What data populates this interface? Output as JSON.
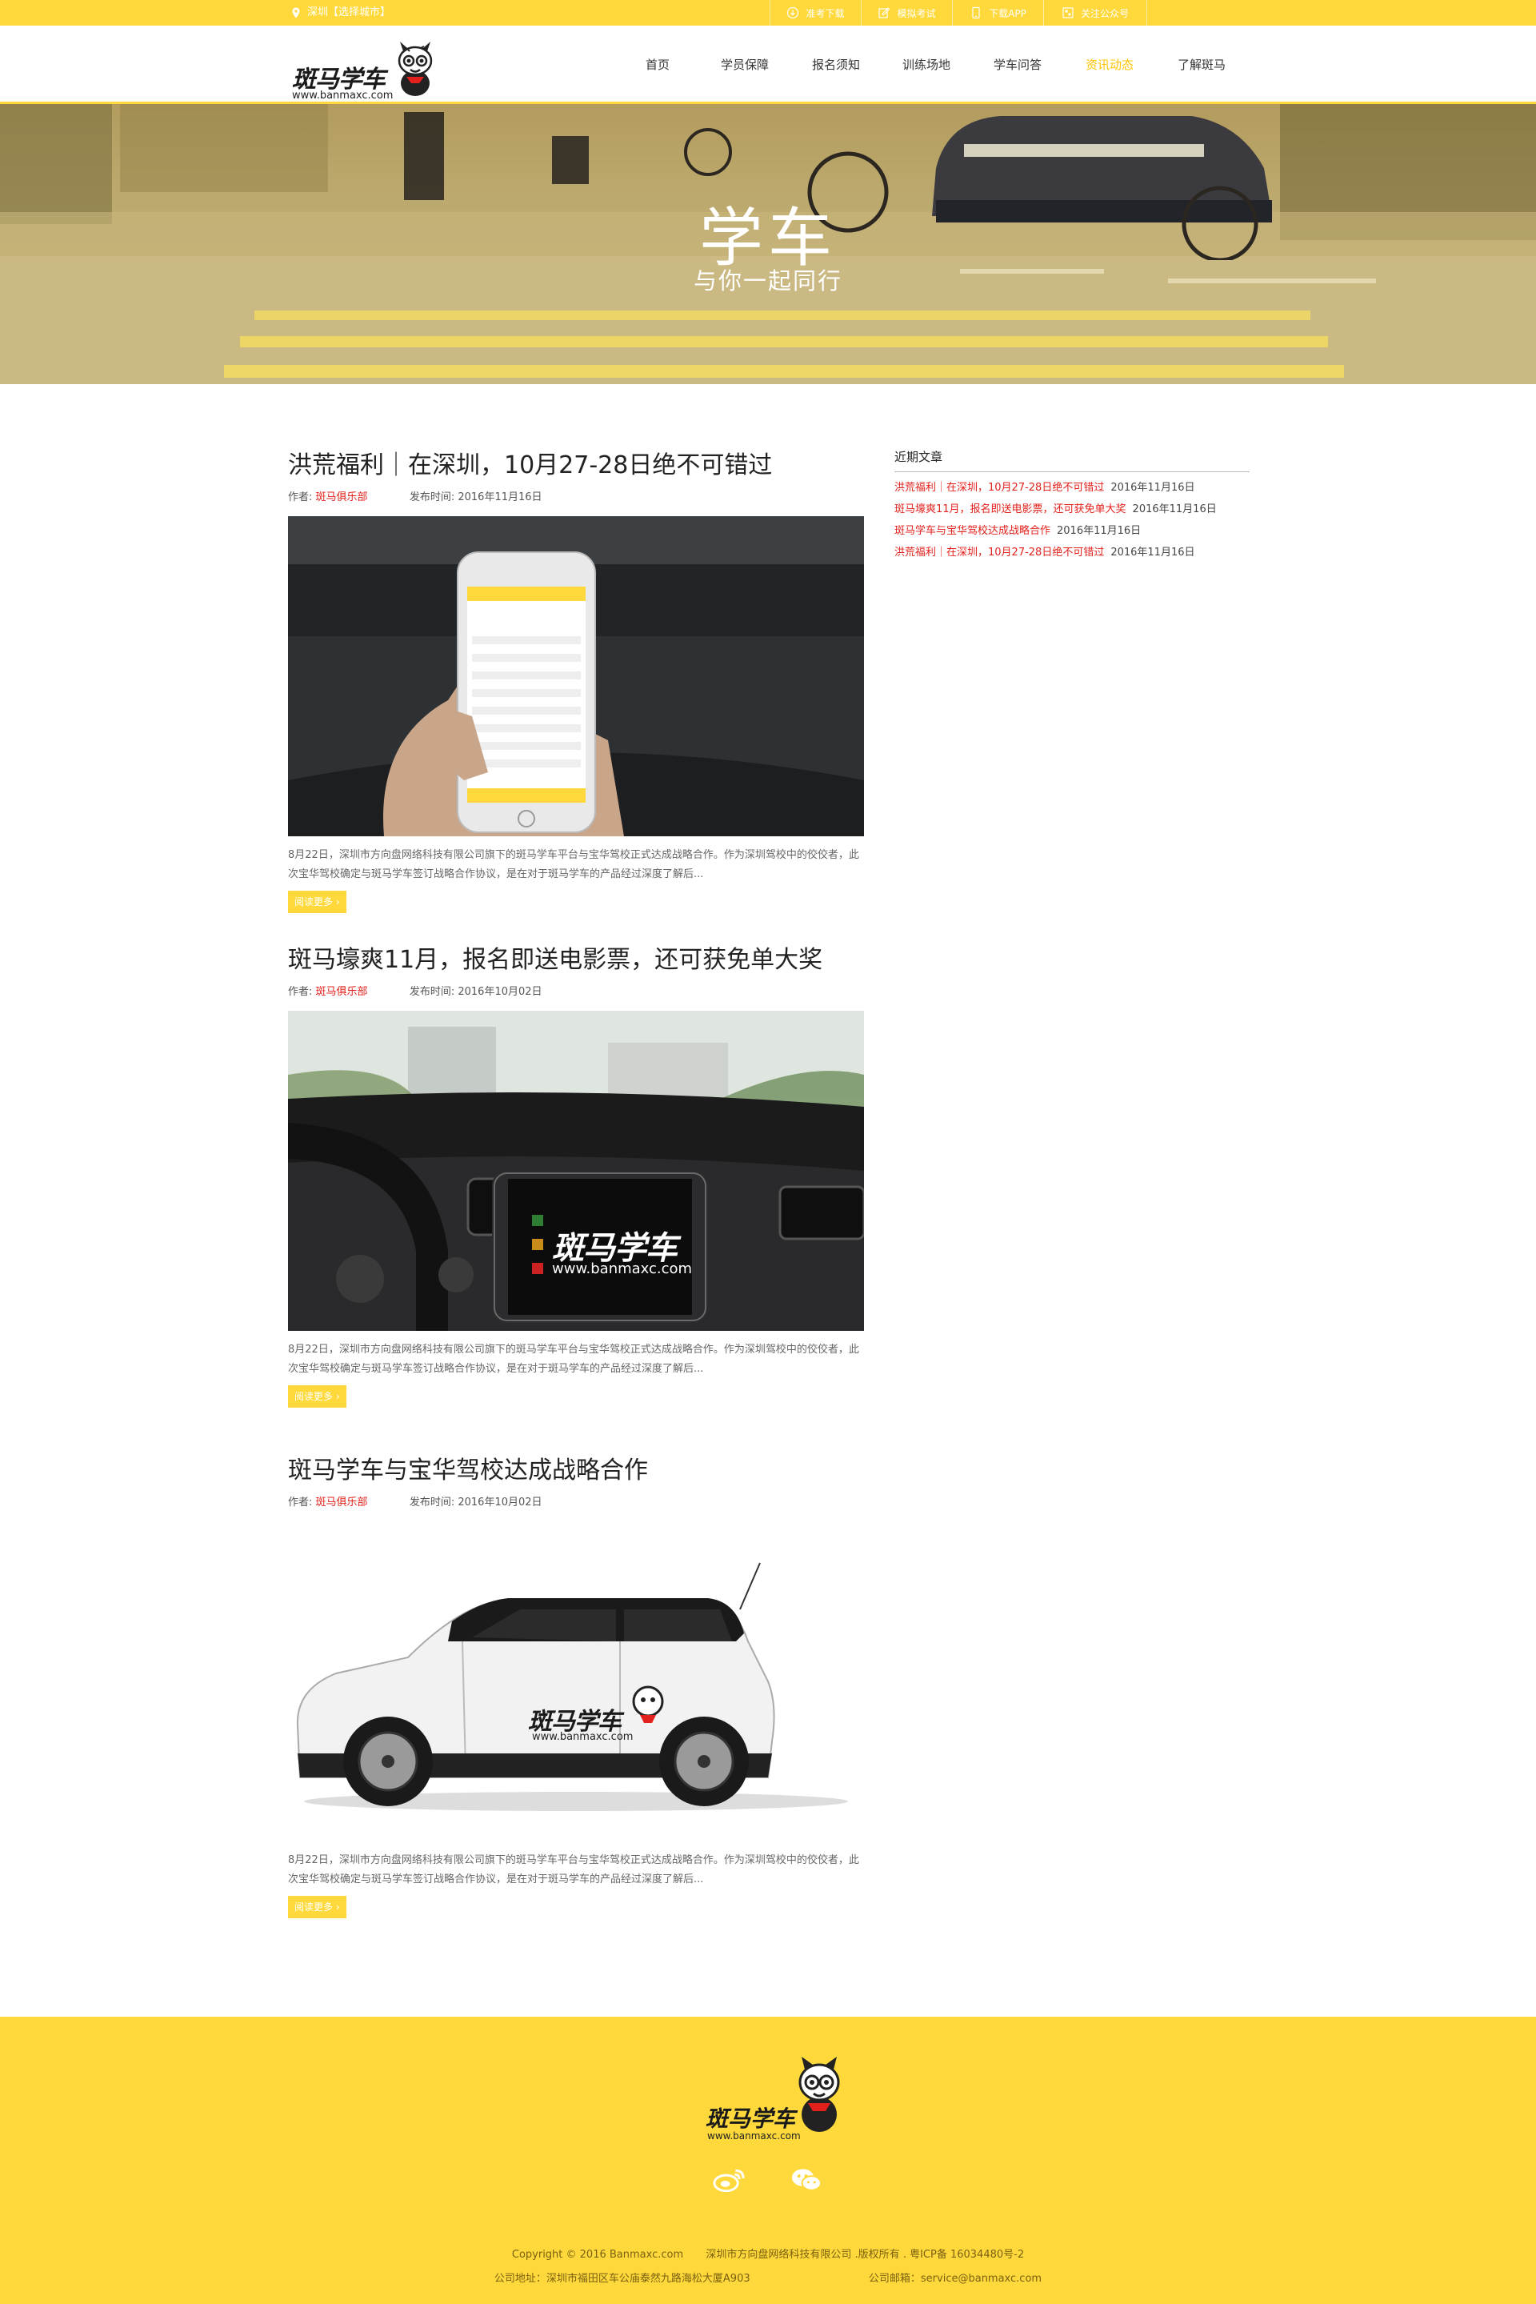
{
  "topbar": {
    "location": "深圳【选择城市】",
    "links": [
      {
        "label": "准考下载",
        "icon": "download-icon"
      },
      {
        "label": "模拟考试",
        "icon": "edit-icon"
      },
      {
        "label": "下载APP",
        "icon": "phone-icon"
      },
      {
        "label": "关注公众号",
        "icon": "wechat-icon"
      }
    ]
  },
  "header": {
    "logo_text": "斑马学车",
    "logo_domain": "www.banmaxc.com",
    "nav": [
      {
        "label": "首页",
        "active": false
      },
      {
        "label": "学员保障",
        "active": false
      },
      {
        "label": "报名须知",
        "active": false
      },
      {
        "label": "训练场地",
        "active": false
      },
      {
        "label": "学车问答",
        "active": false
      },
      {
        "label": "资讯动态",
        "active": true
      },
      {
        "label": "了解斑马",
        "active": false
      }
    ]
  },
  "hero": {
    "title": "学车",
    "subtitle": "与你一起同行"
  },
  "articles": [
    {
      "title": "洪荒福利｜在深圳，10月27-28日绝不可错过",
      "author_label": "作者:",
      "author": "斑马俱乐部",
      "date_label": "发布时间:",
      "date": "2016年11月16日",
      "image": "phone-in-car-photo",
      "desc": "8月22日，深圳市方向盘网络科技有限公司旗下的斑马学车平台与宝华驾校正式达成战略合作。作为深圳驾校中的佼佼者，此次宝华驾校确定与斑马学车签订战略合作协议，是在对于斑马学车的产品经过深度了解后...",
      "more": "阅读更多 ›"
    },
    {
      "title": "斑马壕爽11月，报名即送电影票，还可获免单大奖",
      "author_label": "作者:",
      "author": "斑马俱乐部",
      "date_label": "发布时间:",
      "date": "2016年10月02日",
      "image": "car-dashboard-photo",
      "desc": "8月22日，深圳市方向盘网络科技有限公司旗下的斑马学车平台与宝华驾校正式达成战略合作。作为深圳驾校中的佼佼者，此次宝华驾校确定与斑马学车签订战略合作协议，是在对于斑马学车的产品经过深度了解后...",
      "more": "阅读更多 ›"
    },
    {
      "title": "斑马学车与宝华驾校达成战略合作",
      "author_label": "作者:",
      "author": "斑马俱乐部",
      "date_label": "发布时间:",
      "date": "2016年10月02日",
      "image": "branded-car-photo",
      "desc": "8月22日，深圳市方向盘网络科技有限公司旗下的斑马学车平台与宝华驾校正式达成战略合作。作为深圳驾校中的佼佼者，此次宝华驾校确定与斑马学车签订战略合作协议，是在对于斑马学车的产品经过深度了解后...",
      "more": "阅读更多 ›"
    }
  ],
  "dashboard_brand": {
    "text": "斑马学车",
    "domain": "www.banmaxc.com"
  },
  "car_brand": {
    "text": "斑马学车",
    "domain": "www.banmaxc.com"
  },
  "sidebar": {
    "title": "近期文章",
    "items": [
      {
        "title": "洪荒福利｜在深圳，10月27-28日绝不可错过",
        "date": "2016年11月16日"
      },
      {
        "title": "斑马壕爽11月，报名即送电影票，还可获免单大奖",
        "date": "2016年11月16日"
      },
      {
        "title": "斑马学车与宝华驾校达成战略合作",
        "date": "2016年11月16日"
      },
      {
        "title": "洪荒福利｜在深圳，10月27-28日绝不可错过",
        "date": "2016年11月16日"
      }
    ]
  },
  "footer": {
    "logo_text": "斑马学车",
    "logo_domain": "www.banmaxc.com",
    "icons": [
      "weibo-icon",
      "wechat-icon"
    ],
    "copyright": "Copyright © 2016 Banmaxc.com",
    "company": "深圳市方向盘网络科技有限公司 .版权所有 . 粤ICP备 16034480号-2",
    "address": "公司地址：深圳市福田区车公庙泰然九路海松大厦A903",
    "email": "公司邮箱：service@banmaxc.com"
  },
  "colors": {
    "accent": "#ffd93b",
    "active_nav": "#ffc400",
    "author_red": "#e2211c"
  }
}
